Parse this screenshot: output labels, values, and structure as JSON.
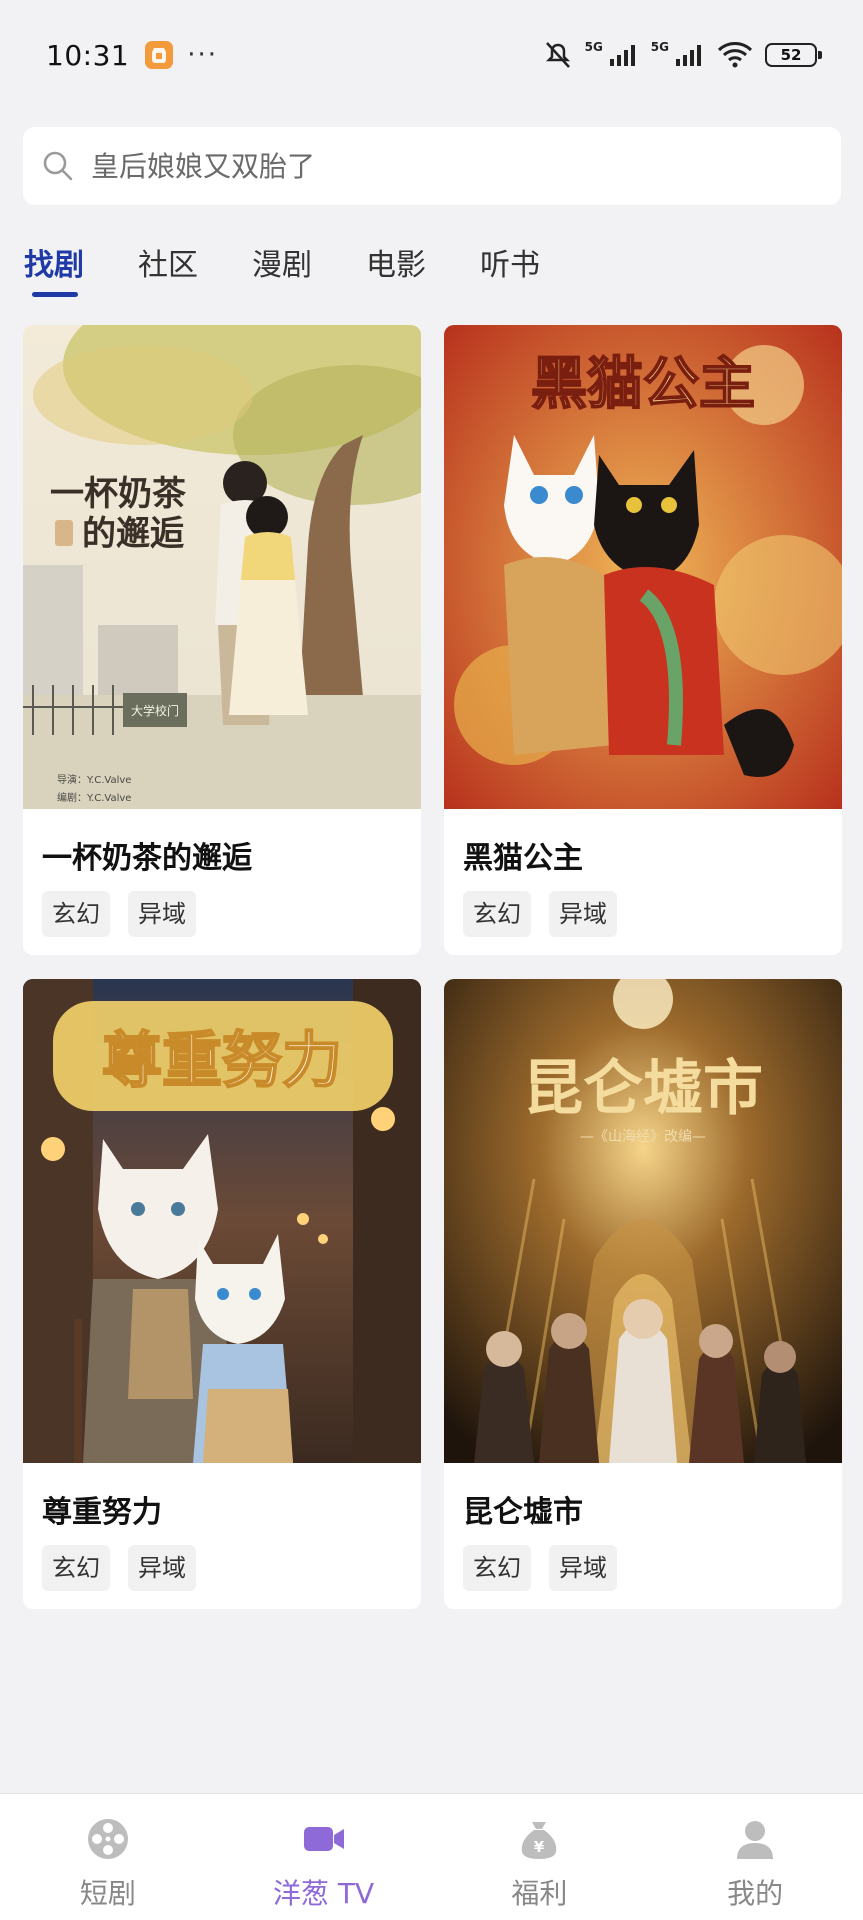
{
  "status_bar": {
    "time": "10:31",
    "signal_label_1": "5G",
    "signal_label_2": "5G",
    "battery": "52"
  },
  "search": {
    "placeholder": "皇后娘娘又双胎了"
  },
  "tabs": [
    {
      "label": "找剧",
      "active": true
    },
    {
      "label": "社区",
      "active": false
    },
    {
      "label": "漫剧",
      "active": false
    },
    {
      "label": "电影",
      "active": false
    },
    {
      "label": "听书",
      "active": false
    }
  ],
  "cards": [
    {
      "title": "一杯奶茶的邂逅",
      "tags": [
        "玄幻",
        "异域"
      ],
      "poster": {
        "title_line1": "一杯奶茶",
        "title_line2": "的邂逅",
        "sign": "大学校门",
        "credit1": "导演：Y.C.Valve",
        "credit2": "编剧：Y.C.Valve"
      }
    },
    {
      "title": "黑猫公主",
      "tags": [
        "玄幻",
        "异域"
      ],
      "poster": {
        "title": "黑猫公主"
      }
    },
    {
      "title": "尊重努力",
      "tags": [
        "玄幻",
        "异域"
      ],
      "poster": {
        "title": "尊重努力"
      }
    },
    {
      "title": "昆仑墟市",
      "tags": [
        "玄幻",
        "异域"
      ],
      "poster": {
        "title": "昆仑墟市",
        "subtitle": "—《山海经》改编—"
      }
    }
  ],
  "bottom_nav": [
    {
      "label": "短剧",
      "icon": "film-reel-icon",
      "active": false
    },
    {
      "label": "洋葱 TV",
      "icon": "video-camera-icon",
      "active": true
    },
    {
      "label": "福利",
      "icon": "money-bag-icon",
      "active": false
    },
    {
      "label": "我的",
      "icon": "person-icon",
      "active": false
    }
  ],
  "colors": {
    "accent": "#1f3aa6",
    "nav_active": "#8e6ad8",
    "background": "#f2f2f4"
  }
}
